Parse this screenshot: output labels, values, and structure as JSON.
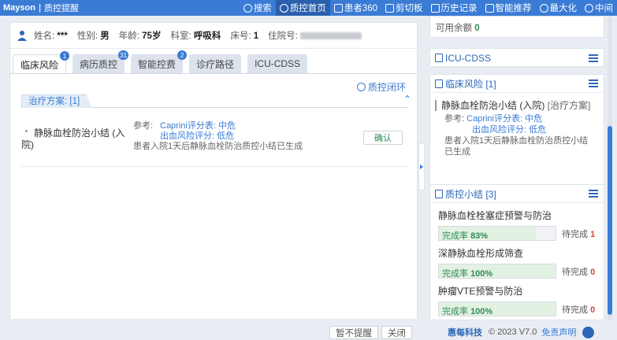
{
  "topbar": {
    "brand": "Mayson",
    "sub": "质控提醒",
    "nav": [
      {
        "label": "搜索",
        "icon": "search-icon"
      },
      {
        "label": "质控首页",
        "icon": "home-icon",
        "active": true
      },
      {
        "label": "患者360",
        "icon": "patient-icon"
      },
      {
        "label": "剪切板",
        "icon": "clipboard-icon"
      },
      {
        "label": "历史记录",
        "icon": "history-icon"
      },
      {
        "label": "智能推荐",
        "icon": "recommend-icon"
      },
      {
        "label": "最大化",
        "icon": "maximize-icon"
      },
      {
        "label": "中asp",
        "icon": "center-icon"
      }
    ]
  },
  "patient": {
    "name_label": "姓名:",
    "name": "***",
    "sex_label": "性别:",
    "sex": "男",
    "age_label": "年龄:",
    "age": "75岁",
    "dept_label": "科室:",
    "dept": "呼吸科",
    "bed_label": "床号:",
    "bed": "1",
    "admission_label": "住院号:"
  },
  "tabs": [
    {
      "label": "临床风险",
      "badge": "1",
      "active": true
    },
    {
      "label": "病历质控",
      "badge": "31"
    },
    {
      "label": "智能控费",
      "badge": "2"
    },
    {
      "label": "诊疗路径",
      "badge": ""
    },
    {
      "label": "ICU-CDSS",
      "badge": ""
    }
  ],
  "content": {
    "loop_label": "质控闭环",
    "plan_tag": "治疗方案: [1]",
    "collapse": "⌃",
    "plan": {
      "name": "静脉血栓防治小结 (入院)",
      "ref_label": "参考:",
      "ref1": "Caprini评分表: 中危",
      "ref2": "出血风险评分: 低危",
      "desc": "患者入院1天后静脉血栓防治质控小结已生成",
      "confirm_label": "确认"
    }
  },
  "buttons": {
    "no_remind": "暂不提醒",
    "close": "关闭"
  },
  "right": {
    "balance_label": "可用余额",
    "balance": "0",
    "icu_title": "ICU-CDSS",
    "risk_title": "临床风险 [1]",
    "risk": {
      "name": "静脉血栓防治小结 (入院)",
      "tag": "[治疗方案]",
      "ref_label": "参考:",
      "ref1": "Caprini评分表: 中危",
      "ref2": "出血风险评分: 低危",
      "desc": "患者入院1天后静脉血栓防治质控小结已生成"
    },
    "qc_title": "质控小结 [3]",
    "qc": [
      {
        "name": "静脉血栓栓塞症预警与防治",
        "rate_label": "完成率",
        "rate": "83%",
        "rate_value": 0.83,
        "pending_label": "待完成",
        "pending": "1"
      },
      {
        "name": "深静脉血栓形成筛查",
        "rate_label": "完成率",
        "rate": "100%",
        "rate_value": 1.0,
        "pending_label": "待完成",
        "pending": "0"
      },
      {
        "name": "肿瘤VTE预警与防治",
        "rate_label": "完成率",
        "rate": "100%",
        "rate_value": 1.0,
        "pending_label": "待完成",
        "pending": "0"
      }
    ]
  },
  "footer": {
    "logo": "惠每科技",
    "copyright": "© 2023 V7.0",
    "disclaimer": "免责声明"
  }
}
